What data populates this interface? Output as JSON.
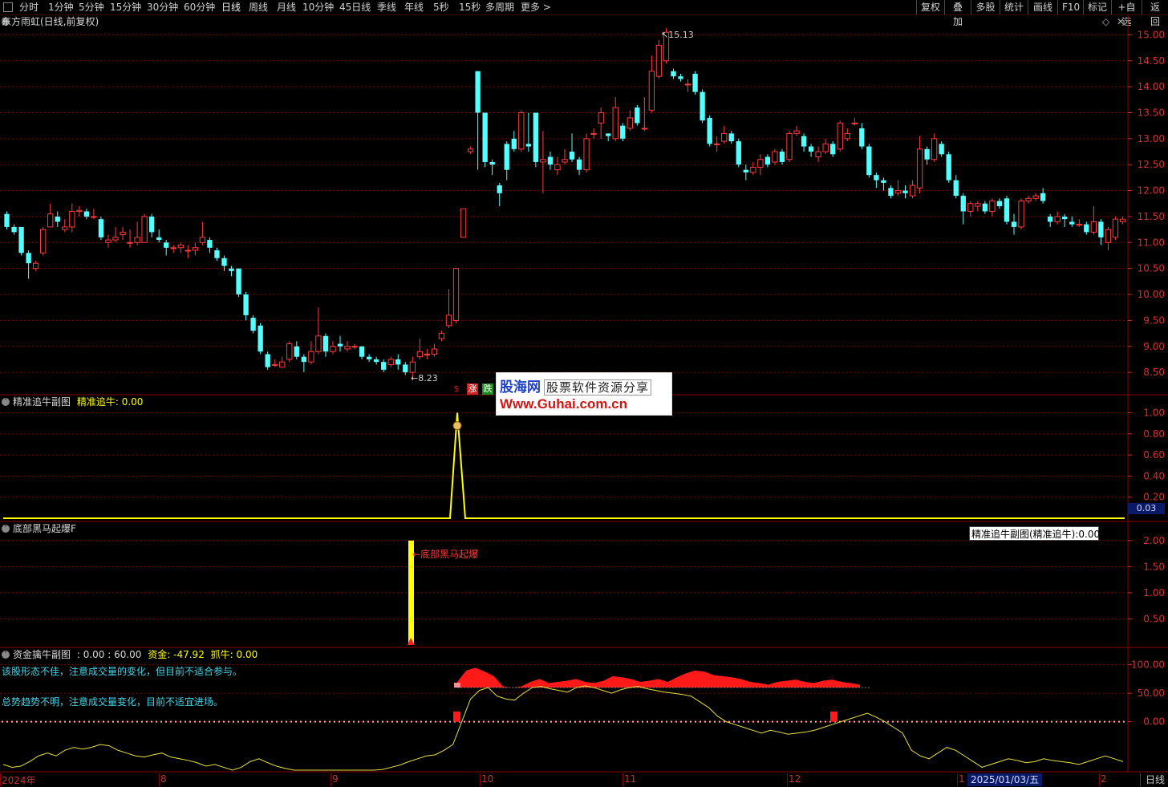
{
  "toolbar": {
    "left_items": [
      "分时",
      "1分钟",
      "5分钟",
      "15分钟",
      "30分钟",
      "60分钟",
      "日线",
      "周线",
      "月线",
      "10分钟",
      "45日线",
      "季线",
      "年线",
      "5秒",
      "15秒",
      "多周期",
      "更多 >"
    ],
    "active": "日线",
    "right_items": [
      "复权",
      "叠加",
      "多股",
      "统计",
      "画线",
      "F10",
      "标记",
      "+自选",
      "返回"
    ]
  },
  "main_pane": {
    "title": "东方雨虹(日线,前复权)",
    "high_label": "15.13",
    "low_label": "8.23",
    "signals": [
      {
        "text": "$",
        "color": "#d21e1e"
      },
      {
        "text": "涨",
        "color": "#d21e1e"
      },
      {
        "text": "跌",
        "color": "#1e8c1e"
      }
    ]
  },
  "pane2": {
    "title": "精准追牛副图",
    "indicator": "精准追牛: 0.00",
    "price_box": "0.03"
  },
  "pane3": {
    "title": "底部黑马起爆F",
    "annotation": "底部黑马起爆",
    "tooltip": "精准追牛副图(精准追牛):0.00"
  },
  "pane4": {
    "title": "资金擒牛副图",
    "values": ": 0.00 : 60.00",
    "fund_label": "资金: -47.92",
    "catch_label": "抓牛: 0.00",
    "note1": "该股形态不佳，注意成交量的变化，但目前不适合参与。",
    "note2": "总势趋势不明，注意成交量变化，目前不适宜进场。"
  },
  "bottom_axis": {
    "labels": [
      "2024年",
      "8",
      "9",
      "10",
      "11",
      "12",
      "1",
      "2"
    ],
    "cursor_date": "2025/01/03/五",
    "period": "日线"
  },
  "watermark": {
    "brand": "股海网",
    "slogan": "股票软件资源分享",
    "url": "Www.Guhai.com.cn"
  },
  "colors": {
    "up": "#ff3c3c",
    "down": "#54ffff",
    "axis": "#d23232",
    "grid": "#8b0000",
    "yellow": "#ffff00"
  },
  "chart_data": [
    {
      "type": "candlestick",
      "title": "东方雨虹(日线,前复权)",
      "y_ticks": [
        8.5,
        9.0,
        9.5,
        10.0,
        10.5,
        11.0,
        11.5,
        12.0,
        12.5,
        13.0,
        13.5,
        14.0,
        14.5,
        15.0
      ],
      "ylim": [
        8.1,
        15.3
      ],
      "annotations": [
        {
          "label": "15.13"
        },
        {
          "label": "8.23"
        }
      ],
      "candles": [
        [
          11.55,
          11.3,
          11.6,
          11.25
        ],
        [
          11.3,
          11.2,
          11.35,
          11.15
        ],
        [
          11.3,
          10.8,
          11.3,
          10.75
        ],
        [
          10.8,
          10.6,
          10.85,
          10.3
        ],
        [
          10.5,
          10.6,
          10.65,
          10.45
        ],
        [
          10.8,
          11.25,
          11.3,
          10.75
        ],
        [
          11.3,
          11.55,
          11.75,
          11.3
        ],
        [
          11.5,
          11.4,
          11.6,
          11.3
        ],
        [
          11.25,
          11.3,
          11.45,
          11.2
        ],
        [
          11.3,
          11.6,
          11.75,
          11.2
        ],
        [
          11.6,
          11.62,
          11.7,
          11.5
        ],
        [
          11.6,
          11.5,
          11.65,
          11.45
        ],
        [
          11.5,
          11.5,
          11.65,
          11.45
        ],
        [
          11.45,
          11.1,
          11.5,
          11.05
        ],
        [
          11.0,
          11.05,
          11.15,
          10.9
        ],
        [
          11.05,
          11.1,
          11.3,
          11.0
        ],
        [
          11.15,
          11.2,
          11.3,
          11.05
        ],
        [
          11.0,
          11.0,
          11.25,
          10.9
        ],
        [
          11.0,
          11.1,
          11.4,
          10.95
        ],
        [
          11.0,
          11.5,
          11.55,
          11.0
        ],
        [
          11.5,
          11.2,
          11.55,
          11.1
        ],
        [
          11.1,
          11.05,
          11.25,
          11.0
        ],
        [
          11.0,
          10.9,
          11.05,
          10.75
        ],
        [
          10.9,
          10.9,
          10.95,
          10.8
        ],
        [
          10.9,
          10.95,
          11.0,
          10.8
        ],
        [
          10.85,
          10.85,
          10.95,
          10.7
        ],
        [
          10.85,
          10.9,
          11.0,
          10.75
        ],
        [
          11.0,
          11.1,
          11.4,
          10.95
        ],
        [
          11.05,
          10.9,
          11.1,
          10.8
        ],
        [
          10.85,
          10.7,
          10.9,
          10.65
        ],
        [
          10.7,
          10.55,
          10.75,
          10.45
        ],
        [
          10.5,
          10.45,
          10.55,
          10.35
        ],
        [
          10.5,
          10.0,
          10.5,
          9.95
        ],
        [
          10.0,
          9.6,
          10.05,
          9.5
        ],
        [
          9.55,
          9.3,
          9.6,
          9.25
        ],
        [
          9.4,
          8.9,
          9.45,
          8.85
        ],
        [
          8.85,
          8.6,
          8.9,
          8.55
        ],
        [
          8.65,
          8.65,
          8.75,
          8.6
        ],
        [
          8.6,
          8.7,
          8.8,
          8.6
        ],
        [
          8.75,
          9.05,
          9.1,
          8.7
        ],
        [
          9.0,
          8.8,
          9.1,
          8.75
        ],
        [
          8.8,
          8.7,
          8.85,
          8.5
        ],
        [
          8.7,
          8.9,
          9.1,
          8.65
        ],
        [
          8.9,
          9.2,
          9.75,
          8.85
        ],
        [
          9.2,
          8.9,
          9.25,
          8.8
        ],
        [
          8.9,
          9.0,
          9.1,
          8.85
        ],
        [
          9.05,
          9.0,
          9.2,
          8.9
        ],
        [
          8.95,
          9.0,
          9.1,
          8.9
        ],
        [
          9.0,
          9.0,
          9.05,
          8.95
        ],
        [
          9.0,
          8.8,
          9.0,
          8.75
        ],
        [
          8.8,
          8.75,
          8.85,
          8.7
        ],
        [
          8.75,
          8.7,
          8.8,
          8.65
        ],
        [
          8.7,
          8.55,
          8.75,
          8.5
        ],
        [
          8.65,
          8.75,
          8.8,
          8.6
        ],
        [
          8.75,
          8.65,
          8.85,
          8.55
        ],
        [
          8.65,
          8.5,
          8.7,
          8.45
        ],
        [
          8.5,
          8.7,
          8.8,
          8.35
        ],
        [
          8.8,
          8.9,
          9.15,
          8.75
        ],
        [
          8.85,
          8.85,
          8.95,
          8.75
        ],
        [
          8.85,
          8.95,
          9.05,
          8.8
        ],
        [
          9.15,
          9.25,
          9.3,
          9.1
        ],
        [
          9.4,
          9.6,
          10.1,
          9.35
        ],
        [
          9.5,
          10.5,
          10.5,
          9.45
        ],
        [
          11.1,
          11.65,
          11.65,
          11.1
        ],
        [
          12.75,
          12.8,
          12.85,
          12.7
        ],
        [
          14.3,
          13.5,
          14.3,
          12.4
        ],
        [
          13.5,
          12.55,
          13.5,
          12.45
        ],
        [
          12.55,
          12.5,
          12.6,
          12.3
        ],
        [
          12.1,
          11.95,
          12.15,
          11.7
        ],
        [
          12.9,
          12.4,
          12.95,
          12.2
        ],
        [
          13.0,
          12.8,
          13.15,
          12.75
        ],
        [
          12.8,
          13.5,
          13.55,
          12.75
        ],
        [
          12.9,
          12.85,
          13.5,
          12.75
        ],
        [
          13.5,
          12.55,
          13.5,
          12.45
        ],
        [
          12.55,
          12.6,
          13.15,
          11.95
        ],
        [
          12.65,
          12.5,
          12.75,
          12.4
        ],
        [
          12.4,
          12.5,
          12.65,
          12.3
        ],
        [
          12.55,
          12.6,
          12.8,
          12.5
        ],
        [
          12.75,
          12.6,
          13.1,
          12.55
        ],
        [
          12.6,
          12.4,
          12.65,
          12.3
        ],
        [
          12.4,
          13.0,
          13.1,
          12.35
        ],
        [
          13.1,
          13.1,
          13.2,
          13.0
        ],
        [
          13.3,
          13.5,
          13.6,
          13.0
        ],
        [
          13.1,
          13.05,
          13.1,
          12.95
        ],
        [
          13.0,
          13.6,
          13.8,
          12.95
        ],
        [
          13.25,
          13.0,
          13.3,
          12.95
        ],
        [
          13.2,
          13.4,
          13.55,
          13.15
        ],
        [
          13.6,
          13.3,
          13.65,
          13.25
        ],
        [
          13.2,
          13.2,
          13.8,
          13.15
        ],
        [
          13.55,
          14.3,
          14.6,
          13.5
        ],
        [
          14.2,
          14.8,
          14.9,
          14.15
        ],
        [
          14.5,
          15.05,
          15.13,
          14.45
        ],
        [
          14.3,
          14.2,
          14.35,
          14.15
        ],
        [
          14.2,
          14.15,
          14.25,
          14.1
        ],
        [
          14.05,
          14.05,
          14.15,
          13.9
        ],
        [
          14.25,
          13.9,
          14.3,
          13.85
        ],
        [
          13.9,
          13.35,
          13.95,
          13.3
        ],
        [
          13.4,
          12.9,
          13.45,
          12.85
        ],
        [
          12.9,
          12.9,
          13.05,
          12.75
        ],
        [
          12.95,
          13.1,
          13.25,
          12.9
        ],
        [
          13.1,
          12.95,
          13.15,
          12.9
        ],
        [
          12.95,
          12.5,
          13.0,
          12.45
        ],
        [
          12.4,
          12.35,
          12.5,
          12.2
        ],
        [
          12.35,
          12.45,
          12.55,
          12.3
        ],
        [
          12.45,
          12.6,
          12.7,
          12.3
        ],
        [
          12.65,
          12.5,
          12.7,
          12.45
        ],
        [
          12.55,
          12.75,
          12.8,
          12.5
        ],
        [
          12.75,
          12.55,
          12.8,
          12.5
        ],
        [
          12.6,
          13.1,
          13.15,
          12.55
        ],
        [
          13.1,
          13.15,
          13.25,
          13.05
        ],
        [
          13.05,
          12.85,
          13.1,
          12.75
        ],
        [
          12.85,
          12.75,
          12.9,
          12.65
        ],
        [
          12.65,
          12.75,
          12.85,
          12.55
        ],
        [
          12.75,
          12.9,
          13.0,
          12.7
        ],
        [
          12.9,
          12.7,
          12.95,
          12.65
        ],
        [
          12.8,
          13.3,
          13.35,
          12.75
        ],
        [
          13.0,
          13.1,
          13.2,
          12.95
        ],
        [
          13.3,
          13.3,
          13.4,
          13.25
        ],
        [
          13.2,
          12.85,
          13.3,
          12.8
        ],
        [
          12.85,
          12.3,
          12.9,
          12.25
        ],
        [
          12.3,
          12.2,
          12.35,
          12.05
        ],
        [
          12.2,
          12.15,
          12.25,
          12.0
        ],
        [
          12.05,
          11.9,
          12.1,
          11.85
        ],
        [
          11.95,
          12.0,
          12.2,
          11.9
        ],
        [
          12.0,
          11.95,
          12.1,
          11.85
        ],
        [
          11.9,
          12.1,
          12.2,
          11.85
        ],
        [
          12.05,
          12.8,
          13.05,
          11.95
        ],
        [
          12.8,
          12.6,
          12.85,
          12.5
        ],
        [
          12.6,
          13.0,
          13.1,
          12.55
        ],
        [
          12.9,
          12.7,
          12.95,
          12.65
        ],
        [
          12.7,
          12.2,
          12.75,
          12.15
        ],
        [
          12.2,
          11.9,
          12.3,
          11.85
        ],
        [
          11.9,
          11.6,
          11.95,
          11.35
        ],
        [
          11.6,
          11.75,
          11.8,
          11.5
        ],
        [
          11.7,
          11.75,
          11.8,
          11.6
        ],
        [
          11.75,
          11.6,
          11.8,
          11.55
        ],
        [
          11.6,
          11.8,
          11.85,
          11.5
        ],
        [
          11.8,
          11.7,
          11.85,
          11.65
        ],
        [
          11.85,
          11.4,
          11.9,
          11.35
        ],
        [
          11.4,
          11.3,
          11.55,
          11.15
        ],
        [
          11.3,
          11.8,
          11.85,
          11.25
        ],
        [
          11.8,
          11.85,
          11.9,
          11.75
        ],
        [
          11.85,
          11.9,
          11.95,
          11.8
        ],
        [
          11.95,
          11.8,
          12.05,
          11.75
        ],
        [
          11.5,
          11.4,
          11.55,
          11.3
        ],
        [
          11.4,
          11.5,
          11.6,
          11.35
        ],
        [
          11.5,
          11.45,
          11.55,
          11.3
        ],
        [
          11.4,
          11.35,
          11.5,
          11.3
        ],
        [
          11.35,
          11.35,
          11.45,
          11.3
        ],
        [
          11.35,
          11.2,
          11.4,
          11.15
        ],
        [
          11.2,
          11.4,
          11.7,
          11.15
        ],
        [
          11.4,
          11.1,
          11.45,
          10.95
        ],
        [
          11.0,
          11.25,
          11.3,
          10.85
        ],
        [
          11.1,
          11.45,
          11.5,
          11.05
        ],
        [
          11.4,
          11.45,
          11.5,
          11.35
        ]
      ]
    },
    {
      "type": "line",
      "title": "精准追牛副图",
      "y_ticks": [
        0.2,
        0.4,
        0.6,
        0.8,
        1.0
      ],
      "ylim": [
        0,
        1.05
      ],
      "series": [
        {
          "name": "精准追牛",
          "values": [
            0,
            0,
            1,
            0,
            0
          ]
        }
      ]
    },
    {
      "type": "bar",
      "title": "底部黑马起爆F",
      "y_ticks": [
        0.5,
        1.0,
        1.5,
        2.0
      ],
      "ylim": [
        0,
        2.15
      ],
      "values": [
        2.0
      ]
    },
    {
      "type": "line",
      "title": "资金擒牛副图",
      "y_ticks": [
        0.0,
        50.0,
        100.0
      ],
      "ylim": [
        -85,
        115
      ],
      "fund_line": [
        -75,
        -80,
        -78,
        -70,
        -60,
        -55,
        -60,
        -50,
        -45,
        -48,
        -45,
        -40,
        -42,
        -50,
        -55,
        -60,
        -62,
        -58,
        -55,
        -62,
        -65,
        -68,
        -72,
        -78,
        -75,
        -80,
        -85,
        -80,
        -70,
        -65,
        -72,
        -78,
        -82,
        -86,
        -88,
        -90,
        -92,
        -90,
        -88,
        -92,
        -94,
        -90,
        -88,
        -84,
        -80,
        -76,
        -70,
        -65,
        -60,
        -58,
        -50,
        -40,
        0,
        40,
        55,
        60,
        45,
        40,
        38,
        50,
        60,
        62,
        58,
        55,
        52,
        60,
        63,
        60,
        55,
        50,
        56,
        60,
        62,
        58,
        55,
        52,
        50,
        48,
        45,
        35,
        25,
        10,
        0,
        -5,
        -10,
        -15,
        -20,
        -15,
        -18,
        -22,
        -20,
        -18,
        -15,
        -10,
        -5,
        0,
        5,
        10,
        15,
        8,
        0,
        -10,
        -20,
        -50,
        -60,
        -65,
        -55,
        -45,
        -50,
        -60,
        -70,
        -80,
        -75,
        -70,
        -65,
        -68,
        -72,
        -70,
        -65,
        -68,
        -70,
        -72,
        -75,
        -70,
        -65,
        -60,
        -65,
        -70
      ],
      "fund_area": [
        70,
        90,
        95,
        88,
        80,
        62,
        60,
        62,
        70,
        75,
        68,
        70,
        72,
        75,
        70,
        68,
        72,
        80,
        78,
        75,
        70,
        72,
        75,
        70,
        78,
        85,
        90,
        88,
        82,
        80,
        78,
        75,
        70,
        68,
        65,
        70,
        72,
        74,
        70,
        68,
        72,
        74,
        70,
        68,
        65
      ]
    }
  ]
}
